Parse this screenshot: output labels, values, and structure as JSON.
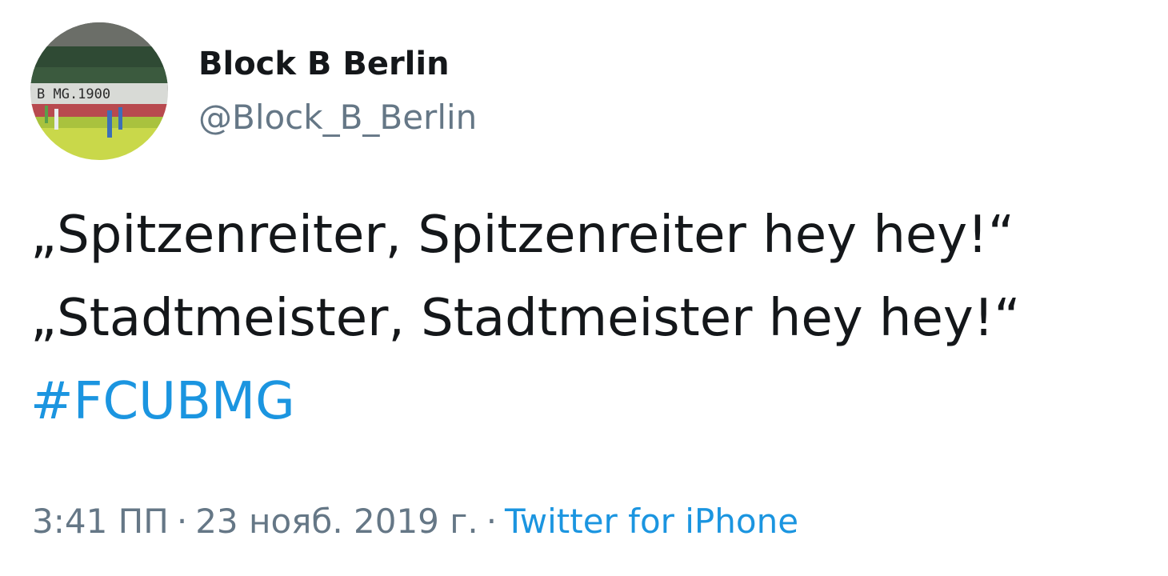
{
  "tweet": {
    "author": {
      "display_name": "Block B Berlin",
      "handle": "@Block_B_Berlin",
      "avatar_banner_text": "B  MG.1900"
    },
    "text_lines": [
      "„Spitzenreiter, Spitzenreiter hey hey!“",
      "„Stadtmeister, Stadtmeister hey hey!“"
    ],
    "hashtag": "#FCUBMG",
    "time": "3:41 ПП",
    "separator": "·",
    "date": "23 нояб. 2019 г.",
    "source": "Twitter for iPhone",
    "colors": {
      "text": "#14171a",
      "secondary": "#657786",
      "link": "#1b95e0"
    }
  }
}
